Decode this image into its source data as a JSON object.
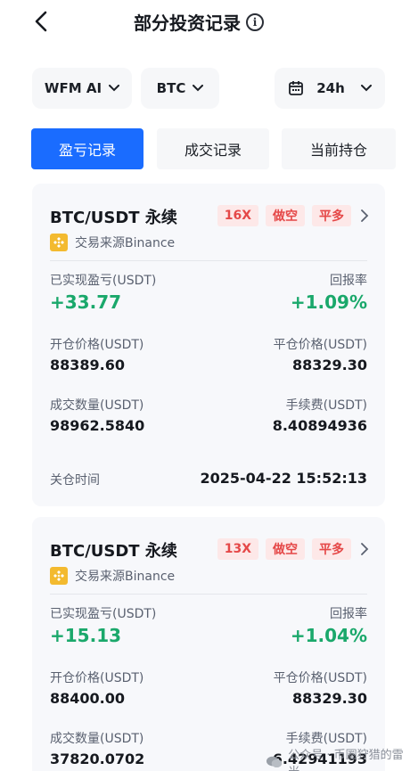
{
  "header": {
    "title": "部分投资记录"
  },
  "filters": {
    "model": "WFM AI",
    "coin": "BTC",
    "period": "24h"
  },
  "tabs": [
    {
      "label": "盈亏记录",
      "active": true
    },
    {
      "label": "成交记录",
      "active": false
    },
    {
      "label": "当前持仓",
      "active": false
    }
  ],
  "records": [
    {
      "pair": "BTC/USDT 永续",
      "leverage": "16X",
      "side": "做空",
      "action": "平多",
      "source": "交易来源Binance",
      "pnl_label": "已实现盈亏(USDT)",
      "pnl_value": "+33.77",
      "roi_label": "回报率",
      "roi_value": "+1.09%",
      "open_label": "开仓价格(USDT)",
      "open_value": "88389.60",
      "close_label": "平仓价格(USDT)",
      "close_value": "88329.30",
      "qty_label": "成交数量(USDT)",
      "qty_value": "98962.5840",
      "fee_label": "手续费(USDT)",
      "fee_value": "8.40894936",
      "time_label": "关仓时间",
      "time_value": "2025-04-22 15:52:13"
    },
    {
      "pair": "BTC/USDT 永续",
      "leverage": "13X",
      "side": "做空",
      "action": "平多",
      "source": "交易来源Binance",
      "pnl_label": "已实现盈亏(USDT)",
      "pnl_value": "+15.13",
      "roi_label": "回报率",
      "roi_value": "+1.04%",
      "open_label": "开仓价格(USDT)",
      "open_value": "88400.00",
      "close_label": "平仓价格(USDT)",
      "close_value": "88329.30",
      "qty_label": "成交数量(USDT)",
      "qty_value": "37820.0702",
      "fee_label": "手续费(USDT)",
      "fee_value": "6.42941193"
    }
  ],
  "footer": {
    "watermark": "公众号 · 币圈狩猎的雷米"
  },
  "colors": {
    "accent": "#1a6cff",
    "profit": "#1aa86b",
    "tag_bg": "#fde8e8",
    "tag_text": "#e54848",
    "binance": "#f3ba2f"
  }
}
